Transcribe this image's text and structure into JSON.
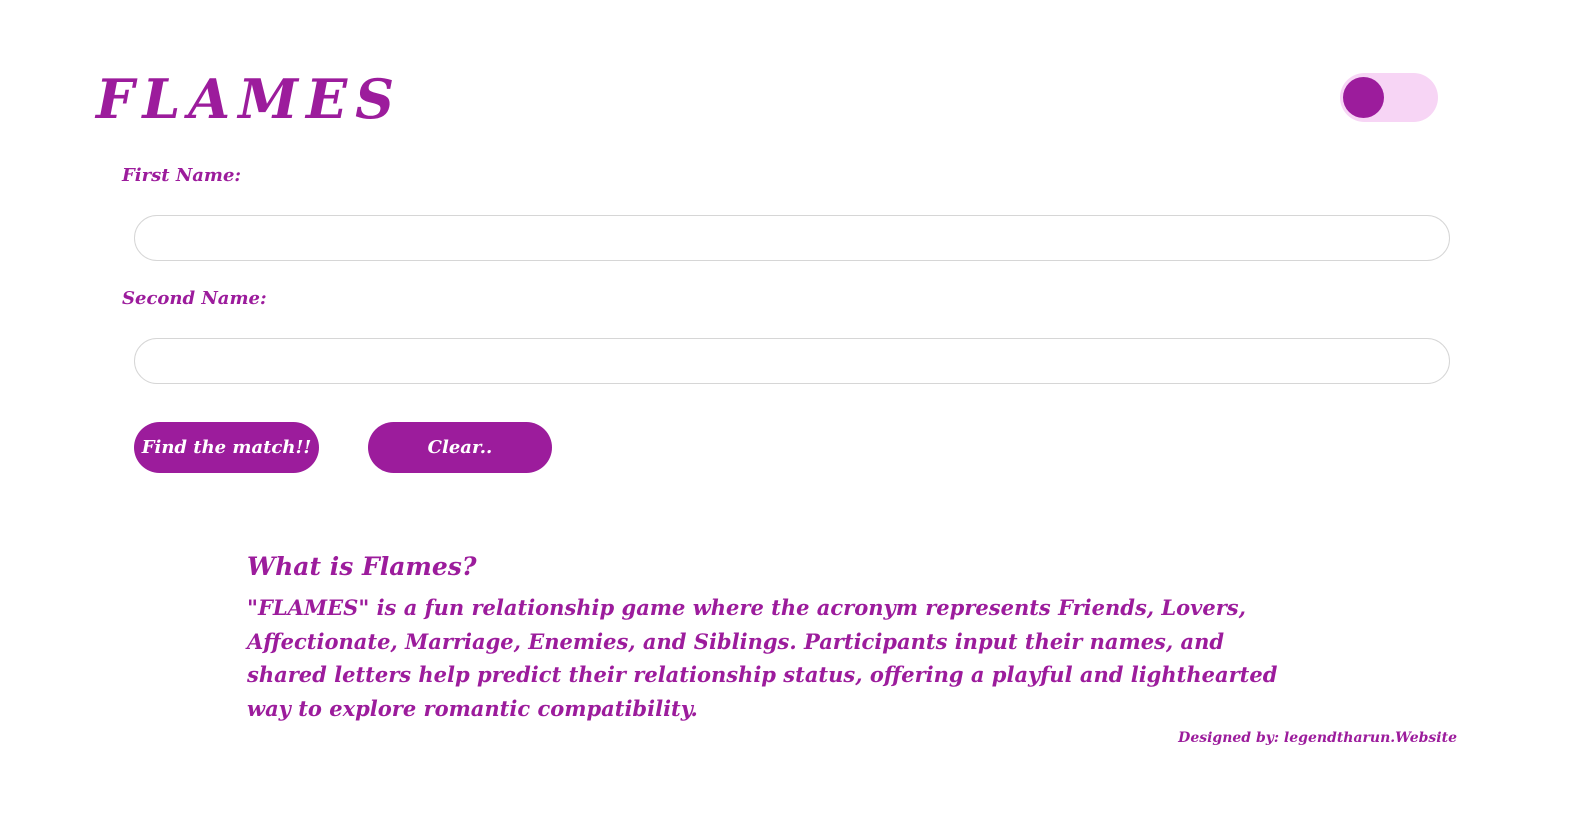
{
  "header": {
    "title": "FLAMES",
    "theme_toggle": {
      "state": "off",
      "track_color": "#f7d5f5",
      "knob_color": "#9c1c9c"
    }
  },
  "form": {
    "first_name_label": "First Name:",
    "first_name_value": "",
    "second_name_label": "Second Name:",
    "second_name_value": "",
    "find_button_label": "Find the match!!",
    "clear_button_label": "Clear.."
  },
  "about": {
    "heading": "What is Flames?",
    "text": "\"FLAMES\" is a fun relationship game where the acronym represents Friends, Lovers, Affectionate, Marriage, Enemies, and Siblings. Participants input their names, and shared letters help predict their relationship status, offering a playful and lighthearted way to explore romantic compatibility."
  },
  "footer": {
    "credit": "Designed by: legendtharun.Website"
  },
  "colors": {
    "accent": "#9c1c9c",
    "background": "#ffffff",
    "input_border": "#d6d6d6"
  }
}
